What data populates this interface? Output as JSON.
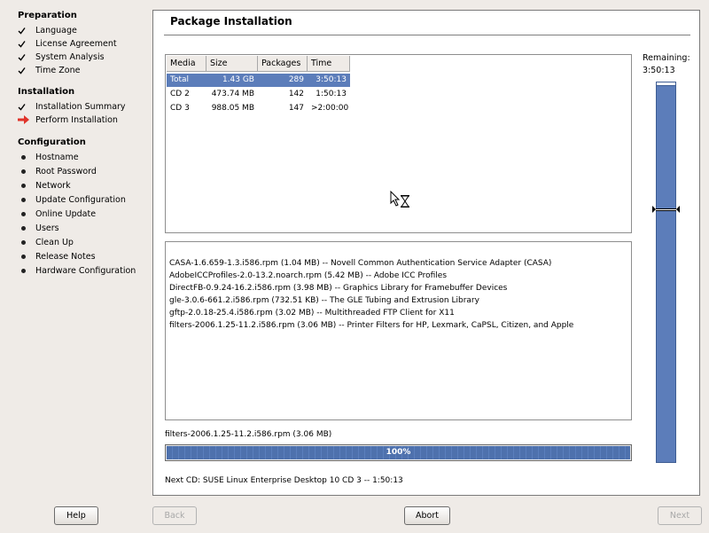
{
  "sidebar": {
    "sections": [
      {
        "title": "Preparation",
        "items": [
          {
            "label": "Language",
            "state": "done"
          },
          {
            "label": "License Agreement",
            "state": "done"
          },
          {
            "label": "System Analysis",
            "state": "done"
          },
          {
            "label": "Time Zone",
            "state": "done"
          }
        ]
      },
      {
        "title": "Installation",
        "items": [
          {
            "label": "Installation Summary",
            "state": "done"
          },
          {
            "label": "Perform Installation",
            "state": "current"
          }
        ]
      },
      {
        "title": "Configuration",
        "items": [
          {
            "label": "Hostname",
            "state": "pending"
          },
          {
            "label": "Root Password",
            "state": "pending"
          },
          {
            "label": "Network",
            "state": "pending"
          },
          {
            "label": "Update Configuration",
            "state": "pending"
          },
          {
            "label": "Online Update",
            "state": "pending"
          },
          {
            "label": "Users",
            "state": "pending"
          },
          {
            "label": "Clean Up",
            "state": "pending"
          },
          {
            "label": "Release Notes",
            "state": "pending"
          },
          {
            "label": "Hardware Configuration",
            "state": "pending"
          }
        ]
      }
    ]
  },
  "main": {
    "title": "Package Installation",
    "table": {
      "headers": [
        "Media",
        "Size",
        "Packages",
        "Time"
      ],
      "rows": [
        {
          "media": "Total",
          "size": "1.43 GB",
          "packages": "289",
          "time": "3:50:13",
          "selected": true
        },
        {
          "media": "CD 2",
          "size": "473.74 MB",
          "packages": "142",
          "time": "1:50:13",
          "selected": false
        },
        {
          "media": "CD 3",
          "size": "988.05 MB",
          "packages": "147",
          "time": ">2:00:00",
          "selected": false
        }
      ]
    },
    "log": [
      "CASA-1.6.659-1.3.i586.rpm (1.04 MB) -- Novell Common Authentication Service Adapter (CASA)",
      "AdobeICCProfiles-2.0-13.2.noarch.rpm (5.42 MB) -- Adobe ICC Profiles",
      "DirectFB-0.9.24-16.2.i586.rpm (3.98 MB) -- Graphics Library for Framebuffer Devices",
      "gle-3.0.6-661.2.i586.rpm (732.51 KB) -- The GLE Tubing and Extrusion Library",
      "gftp-2.0.18-25.4.i586.rpm (3.02 MB) -- Multithreaded FTP Client for X11",
      "filters-2006.1.25-11.2.i586.rpm (3.06 MB) -- Printer Filters for HP, Lexmark, CaPSL, Citizen, and Apple"
    ],
    "current_package": "filters-2006.1.25-11.2.i586.rpm (3.06 MB)",
    "progress": {
      "percent": 100,
      "label": "100%"
    },
    "next_cd": "Next CD: SUSE Linux Enterprise Desktop 10 CD 3 -- 1:50:13",
    "remaining": {
      "label": "Remaining:",
      "value": "3:50:13",
      "fraction_done": 0.33
    }
  },
  "buttons": {
    "help": "Help",
    "back": "Back",
    "abort": "Abort",
    "next": "Next"
  },
  "colors": {
    "selection": "#5c7dba",
    "progress": "#4e71ad",
    "current_arrow": "#e0332a"
  }
}
